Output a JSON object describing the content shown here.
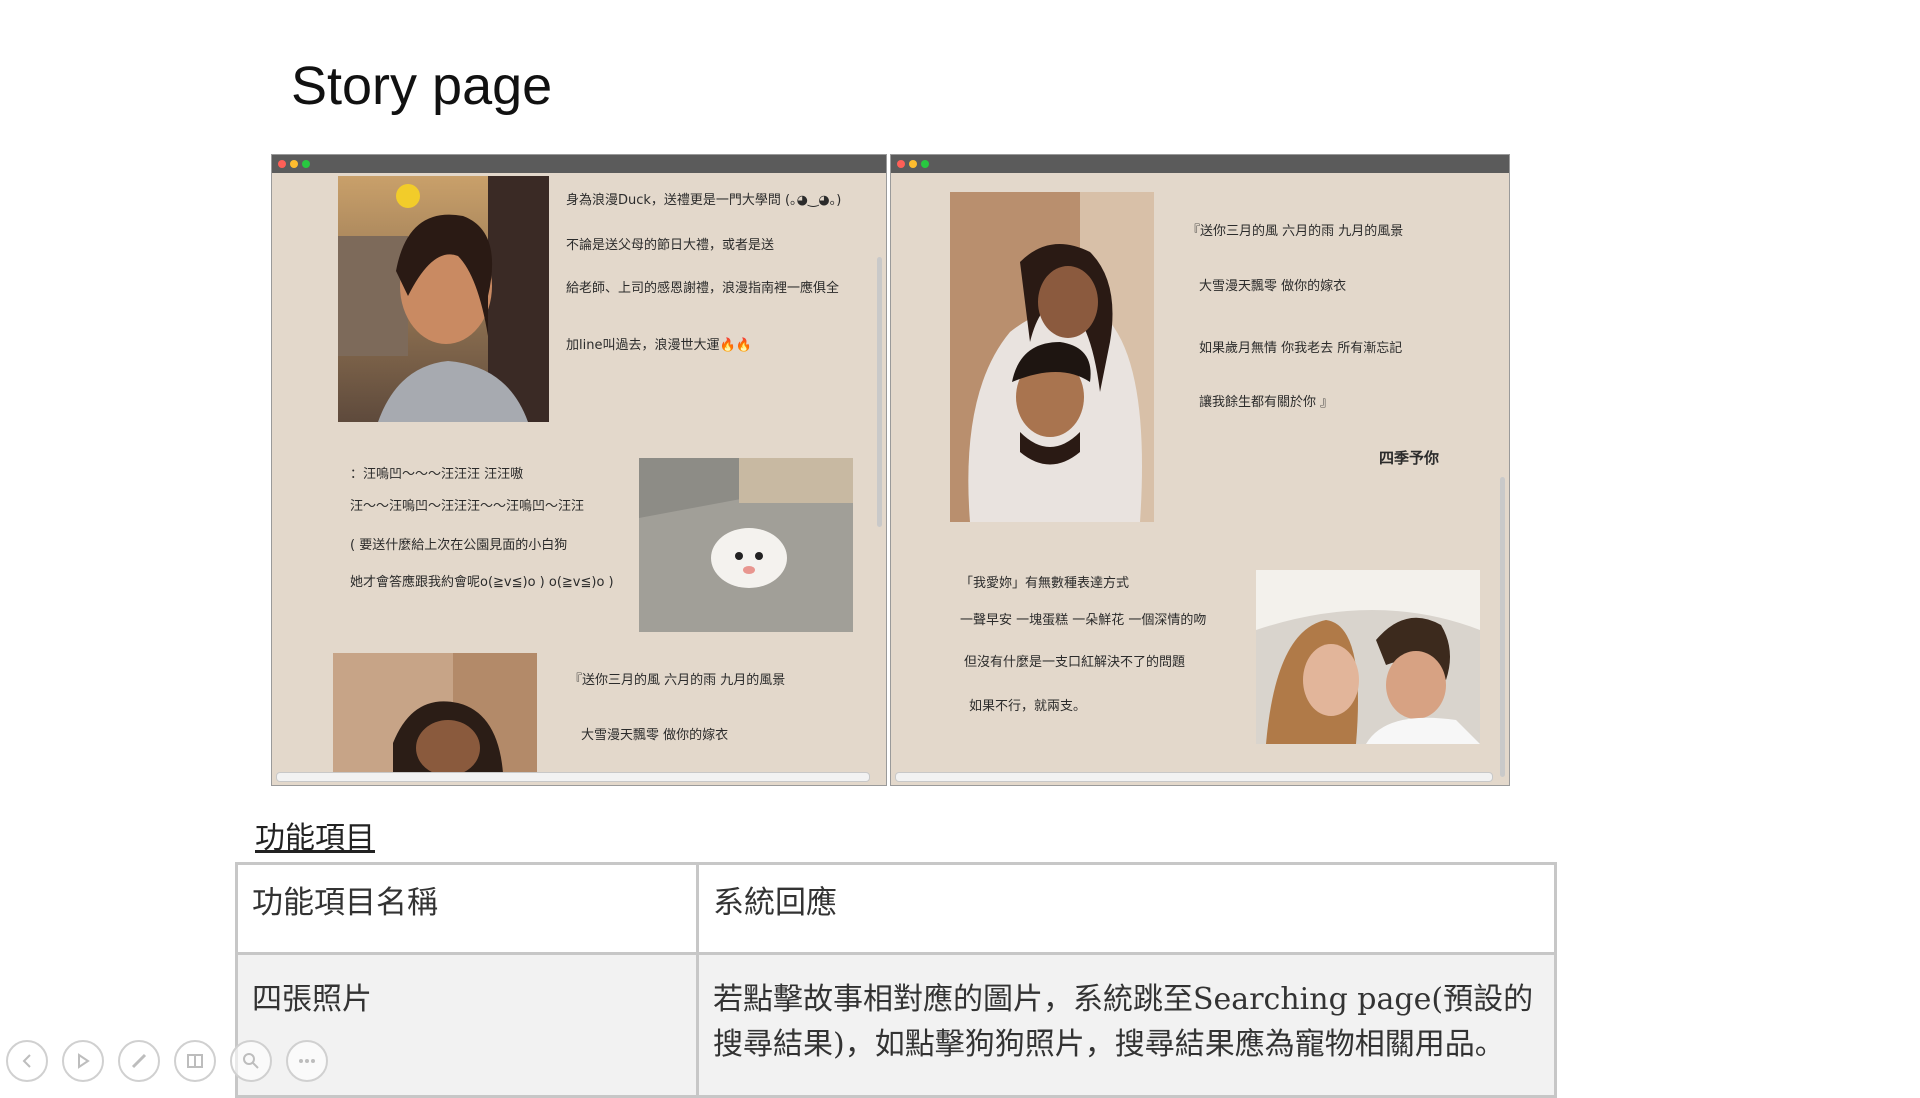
{
  "slide": {
    "title": "Story page"
  },
  "left_window": {
    "block1": {
      "photo": "woman-smiling-photo",
      "lines": [
        "身為浪漫Duck，送禮更是一門大學問 (｡◕‿◕｡)",
        "不論是送父母的節日大禮，或者是送",
        "給老師、上司的感恩謝禮，浪漫指南裡一應俱全",
        "加line叫過去，浪漫世大運🔥🔥"
      ]
    },
    "block2": {
      "photo": "white-puppy-photo",
      "lines": [
        "：汪嗚凹～～～汪汪汪 汪汪嗷",
        "汪～～汪嗚凹～汪汪汪～～汪嗚凹～汪汪",
        "( 要送什麼給上次在公園見面的小白狗",
        "她才會答應跟我約會呢o(≧v≦)o ) o(≧v≦)o )"
      ]
    },
    "block3": {
      "photo": "couple-photo-partial",
      "lines": [
        "『送你三月的風 六月的雨 九月的風景",
        "大雪漫天飄零 做你的嫁衣"
      ]
    }
  },
  "right_window": {
    "block1": {
      "photo": "couple-hugging-photo",
      "lines": [
        "『送你三月的風 六月的雨 九月的風景",
        "大雪漫天飄零 做你的嫁衣",
        "如果歲月無情 你我老去 所有漸忘記",
        "讓我餘生都有關於你 』"
      ],
      "signature": "四季予你"
    },
    "block2": {
      "photo": "couple-bed-photo",
      "lines": [
        "「我愛妳」有無數種表達方式",
        "一聲早安 一塊蛋糕 一朵鮮花 一個深情的吻",
        "但沒有什麼是一支口紅解決不了的問題",
        "如果不行，就兩支。"
      ]
    }
  },
  "section": {
    "label": "功能項目"
  },
  "table": {
    "headers": [
      "功能項目名稱",
      "系統回應"
    ],
    "rows": [
      [
        "四張照片",
        "若點擊故事相對應的圖片，系統跳至Searching page(預設的搜尋結果)，如點擊狗狗照片，搜尋結果應為寵物相關用品。"
      ]
    ]
  },
  "toolbar": {
    "buttons": [
      "prev-icon",
      "next-icon",
      "pen-icon",
      "slides-icon",
      "zoom-icon",
      "more-icon"
    ]
  }
}
